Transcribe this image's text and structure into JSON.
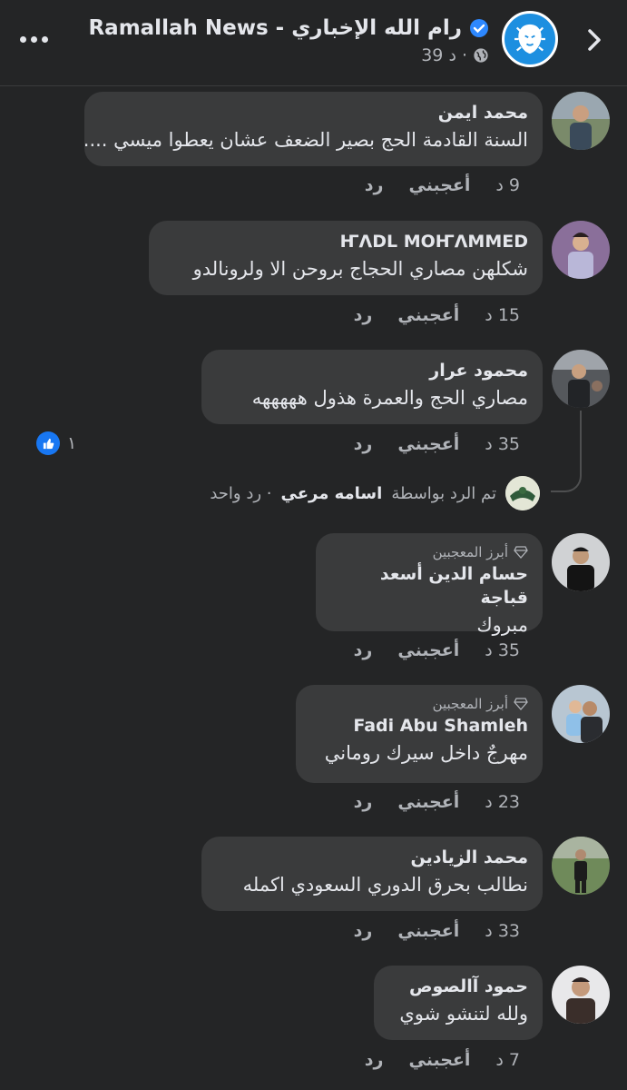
{
  "header": {
    "page_name": "Ramallah News - رام الله  الإخباري",
    "meta": "39 د ·",
    "icons": [
      "back-chevron-icon",
      "verified-badge-icon",
      "globe-icon",
      "more-dots-icon"
    ],
    "accent_color": "#1d8fe0"
  },
  "comments": [
    {
      "name": "محمد ايمن",
      "text": "السنة القادمة الحج بصير الضعف عشان يعطوا ميسي ....",
      "time": "9 د",
      "like": "أعجبني",
      "reply": "رد"
    },
    {
      "name": "ҤΛDL MOҤΛMMED",
      "text": "شكلهن مصاري الحجاج بروحن الا ولرونالدو",
      "time": "15 د",
      "like": "أعجبني",
      "reply": "رد"
    },
    {
      "name": "محمود عرار",
      "text": "مصاري الحج والعمرة هذول هههههه",
      "time": "35 د",
      "like": "أعجبني",
      "reply": "رد",
      "reaction_count": "١"
    },
    {
      "badge": "أبرز المعجبين",
      "name": "حسام الدين أسعد قباجة",
      "text": "مبروك",
      "time": "35 د",
      "like": "أعجبني",
      "reply": "رد"
    },
    {
      "badge": "أبرز المعجبين",
      "name": "Fadi Abu Shamleh",
      "text": "مهرجٌ داخل سيرك روماني",
      "time": "23 د",
      "like": "أعجبني",
      "reply": "رد"
    },
    {
      "name": "محمد الزيادين",
      "text": "نطالب بحرق الدوري السعودي اكمله",
      "time": "33 د",
      "like": "أعجبني",
      "reply": "رد"
    },
    {
      "name": "حمود آالصوص",
      "text": "ولله لتنشو شوي",
      "time": "7 د",
      "like": "أعجبني",
      "reply": "رد"
    }
  ],
  "reply_summary": {
    "prefix": "تم الرد بواسطة",
    "replier": "اسامه مرعي",
    "count": "· رد واحد"
  }
}
